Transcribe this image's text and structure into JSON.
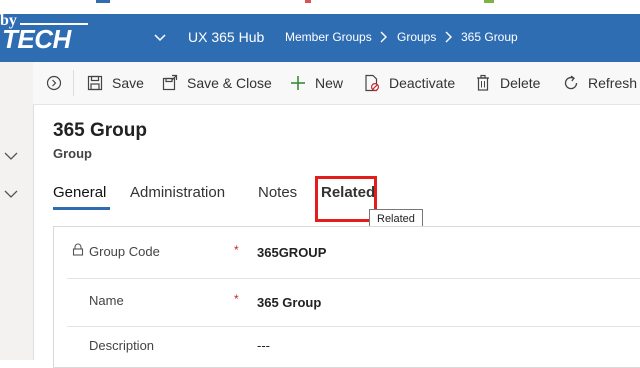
{
  "logo": {
    "line1": "by",
    "line2": "TECH"
  },
  "app": {
    "name": "UX 365 Hub"
  },
  "breadcrumb": [
    "Member Groups",
    "Groups",
    "365 Group"
  ],
  "commands": [
    {
      "label": "Save",
      "icon": "save-icon"
    },
    {
      "label": "Save & Close",
      "icon": "save-close-icon"
    },
    {
      "label": "New",
      "icon": "plus-icon"
    },
    {
      "label": "Deactivate",
      "icon": "deactivate-icon"
    },
    {
      "label": "Delete",
      "icon": "trash-icon"
    },
    {
      "label": "Refresh",
      "icon": "refresh-icon"
    }
  ],
  "record": {
    "title": "365 Group",
    "type": "Group"
  },
  "tabs": [
    "General",
    "Administration",
    "Notes",
    "Related"
  ],
  "active_tab": "General",
  "tooltip": "Related",
  "fields": [
    {
      "label": "Group Code",
      "required": "*",
      "value": "365GROUP",
      "locked": true
    },
    {
      "label": "Name",
      "required": "*",
      "value": "365 Group",
      "locked": false
    },
    {
      "label": "Description",
      "required": "",
      "value": "---",
      "locked": false
    }
  ],
  "colors": {
    "nav": "#2f6db3",
    "highlight": "#e51c1c",
    "required": "#c4262e"
  }
}
